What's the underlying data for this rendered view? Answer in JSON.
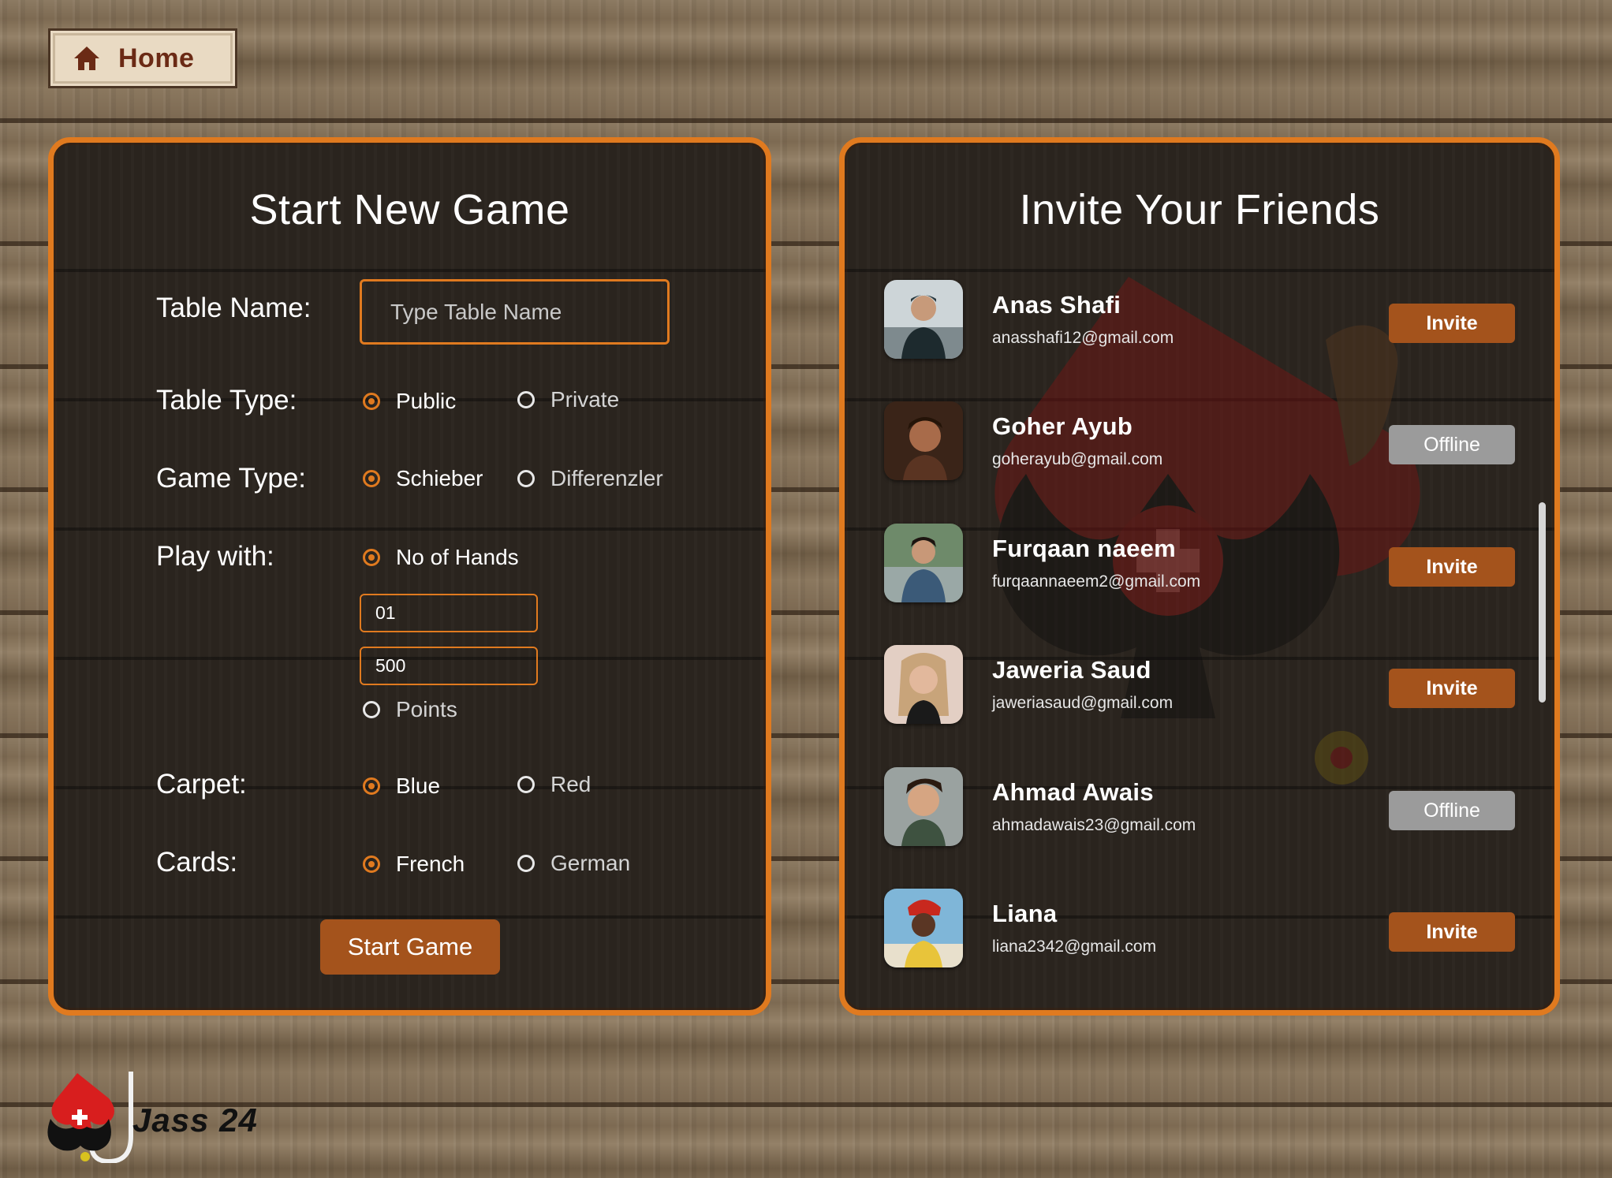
{
  "nav": {
    "home_label": "Home"
  },
  "start_game": {
    "title": "Start New Game",
    "table_name": {
      "label": "Table Name:",
      "placeholder": "Type Table Name",
      "value": ""
    },
    "table_type": {
      "label": "Table Type:",
      "options": [
        "Public",
        "Private"
      ],
      "selected": "Public"
    },
    "game_type": {
      "label": "Game Type:",
      "options": [
        "Schieber",
        "Differenzler"
      ],
      "selected": "Schieber"
    },
    "play_with": {
      "label": "Play with:",
      "hands_option": "No of Hands",
      "hands_value": "01",
      "points_value": "500",
      "points_option": "Points",
      "selected": "No of Hands"
    },
    "carpet": {
      "label": "Carpet:",
      "options": [
        "Blue",
        "Red"
      ],
      "selected": "Blue"
    },
    "cards": {
      "label": "Cards:",
      "options": [
        "French",
        "German"
      ],
      "selected": "French"
    },
    "start_label": "Start Game"
  },
  "invite": {
    "title": "Invite Your Friends",
    "friends": [
      {
        "name": "Anas Shafi",
        "email": "anasshafi12@gmail.com",
        "action": "Invite"
      },
      {
        "name": "Goher Ayub",
        "email": "goherayub@gmail.com",
        "action": "Offline"
      },
      {
        "name": "Furqaan naeem",
        "email": "furqaannaeem2@gmail.com",
        "action": "Invite"
      },
      {
        "name": "Jaweria Saud",
        "email": "jaweriasaud@gmail.com",
        "action": "Invite"
      },
      {
        "name": "Ahmad Awais",
        "email": "ahmadawais23@gmail.com",
        "action": "Offline"
      },
      {
        "name": "Liana",
        "email": "liana2342@gmail.com",
        "action": "Invite"
      }
    ]
  },
  "brand": {
    "name": "Jass 24"
  },
  "colors": {
    "accent": "#e07a1f",
    "button": "#a4531c",
    "offline": "#9b9b9b",
    "panel": "#2a241e"
  }
}
